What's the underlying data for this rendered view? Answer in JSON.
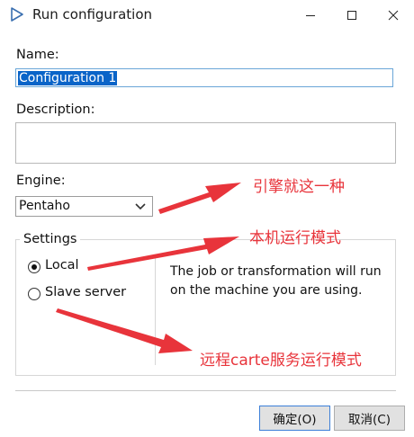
{
  "window": {
    "title": "Run configuration"
  },
  "form": {
    "name_label": "Name:",
    "name_value": "Configuration 1",
    "description_label": "Description:",
    "description_value": "",
    "engine_label": "Engine:",
    "engine_value": "Pentaho"
  },
  "settings": {
    "title": "Settings",
    "options": [
      {
        "label": "Local",
        "selected": true
      },
      {
        "label": "Slave server",
        "selected": false
      }
    ],
    "description": "The job or transformation will run on the machine you are using."
  },
  "buttons": {
    "ok": "确定(O)",
    "cancel": "取消(C)"
  },
  "annotations": {
    "engine_note": "引擎就这一种",
    "local_note": "本机运行模式",
    "slave_note": "远程carte服务运行模式",
    "color": "#e8343b"
  },
  "colors": {
    "selection": "#0a64c8",
    "focus_border": "#6aa6d8"
  }
}
